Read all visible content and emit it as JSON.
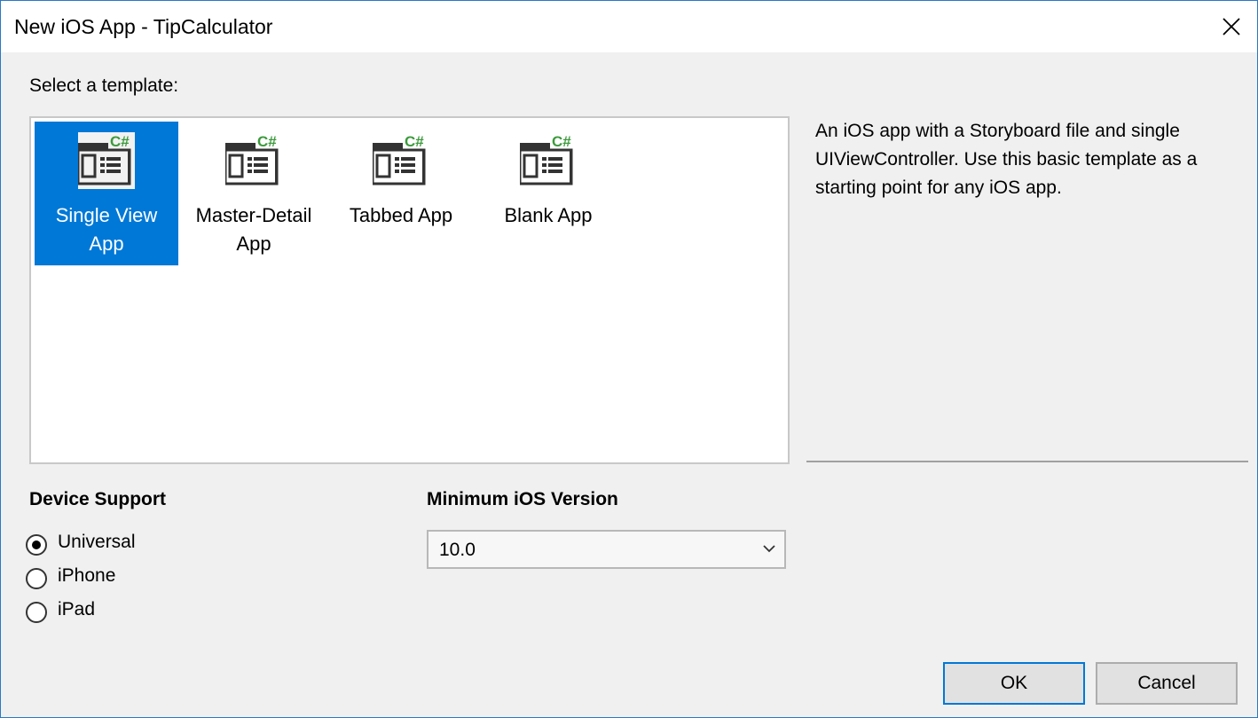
{
  "window": {
    "title": "New iOS App - TipCalculator"
  },
  "template_section": {
    "label": "Select a template:",
    "templates": [
      {
        "label_line1": "Single View",
        "label_line2": "App",
        "selected": true,
        "icon": "csharp-template-icon"
      },
      {
        "label_line1": "Master-Detail",
        "label_line2": "App",
        "selected": false,
        "icon": "csharp-template-icon"
      },
      {
        "label_line1": "Tabbed App",
        "label_line2": "",
        "selected": false,
        "icon": "csharp-template-icon"
      },
      {
        "label_line1": "Blank App",
        "label_line2": "",
        "selected": false,
        "icon": "csharp-template-icon"
      }
    ],
    "description": "An iOS app with a Storyboard file and single UIViewController. Use this basic template as a starting point for any iOS app."
  },
  "device_support": {
    "heading": "Device Support",
    "options": [
      {
        "label": "Universal",
        "checked": true
      },
      {
        "label": "iPhone",
        "checked": false
      },
      {
        "label": "iPad",
        "checked": false
      }
    ]
  },
  "min_ios": {
    "heading": "Minimum iOS Version",
    "value": "10.0"
  },
  "buttons": {
    "ok": "OK",
    "cancel": "Cancel"
  },
  "colors": {
    "accent": "#0078d7",
    "csharp_badge": "#3c9a3c"
  }
}
